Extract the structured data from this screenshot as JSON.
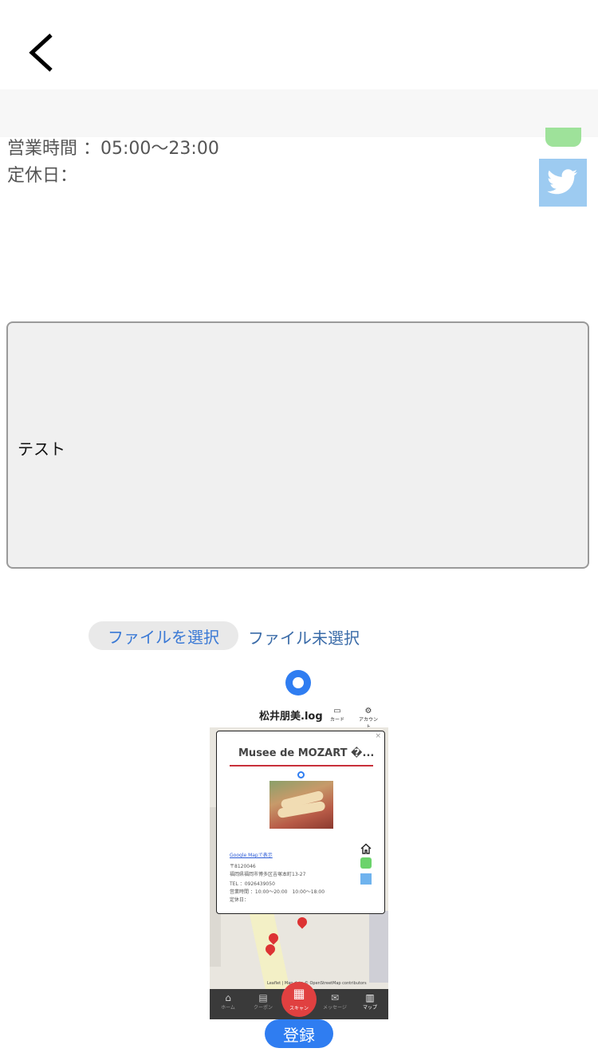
{
  "nav": {
    "back_icon": "chevron-left-icon"
  },
  "store": {
    "hours_label": "営業時間",
    "hours_value": "：05:00〜23:00",
    "closed_label": "定休日：",
    "twitter_icon": "twitter-icon",
    "line_icon": "line-icon"
  },
  "comment": {
    "value": "テスト"
  },
  "file": {
    "choose_label": "ファイルを選択",
    "status": "ファイル未選択"
  },
  "preview": {
    "app_title": "松井朋美.log",
    "icons": [
      {
        "label": "カード",
        "icon": "card-icon"
      },
      {
        "label": "アカウント",
        "icon": "gear-icon"
      }
    ],
    "popup": {
      "name": "Musee de MOZART �...",
      "link": "Google Mapで表示",
      "lines": [
        "〒8120046",
        "福岡県福岡市博多区吉塚本町13-27",
        "TEL ：0926439050",
        "営業時間 ：10:00〜20:00　10:00〜18:00",
        "定休日："
      ]
    },
    "zoom": [
      "+",
      "−"
    ],
    "credit": "Leaflet | Map data © OpenStreetMap contributors",
    "tabs": [
      {
        "label": "ホーム",
        "icon": "home-icon"
      },
      {
        "label": "クーポン",
        "icon": "coupon-icon"
      },
      {
        "label": "メッセージ",
        "icon": "mail-icon"
      },
      {
        "label": "マップ",
        "icon": "map-icon"
      }
    ],
    "scan_label": "スキャン"
  },
  "submit_label": "登録",
  "colors": {
    "accent": "#2f7df1",
    "twitter": "#9dcbf1",
    "line": "#9ee29a",
    "scan": "#e04040"
  }
}
